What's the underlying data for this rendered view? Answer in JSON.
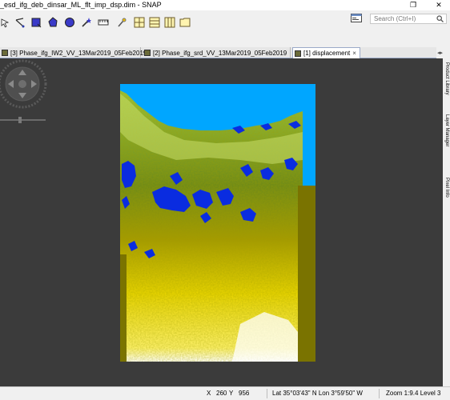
{
  "window": {
    "title": "_esd_ifg_deb_dinsar_ML_flt_imp_dsp.dim - SNAP",
    "restore_glyph": "❐",
    "close_glyph": "✕"
  },
  "search": {
    "placeholder": "Search (Ctrl+I)"
  },
  "tabs": [
    {
      "label": "[3] Phase_ifg_IW2_VV_13Mar2019_05Feb2019",
      "active": false
    },
    {
      "label": "[2] Phase_ifg_srd_VV_13Mar2019_05Feb2019",
      "active": false
    },
    {
      "label": "[1] displacement",
      "active": true
    }
  ],
  "tab_close_glyph": "×",
  "tab_scroll_glyph": "◂▸",
  "side_panels": [
    "Product Library",
    "Layer Manager",
    "Pixel Info"
  ],
  "status": {
    "x_label": "X",
    "x_value": "260",
    "y_label": "Y",
    "y_value": "956",
    "latlon": "Lat 35°03'43\" N  Lon 3°59'50\" W",
    "zoom": "Zoom 1:9.4  Level 3"
  },
  "colors": {
    "view_bg": "#3b3b3b",
    "raster_sea": "#00a6ff",
    "raster_olive": "#7a7300",
    "raster_yellow": "#f5e400",
    "raster_blue": "#0a2ce0"
  }
}
